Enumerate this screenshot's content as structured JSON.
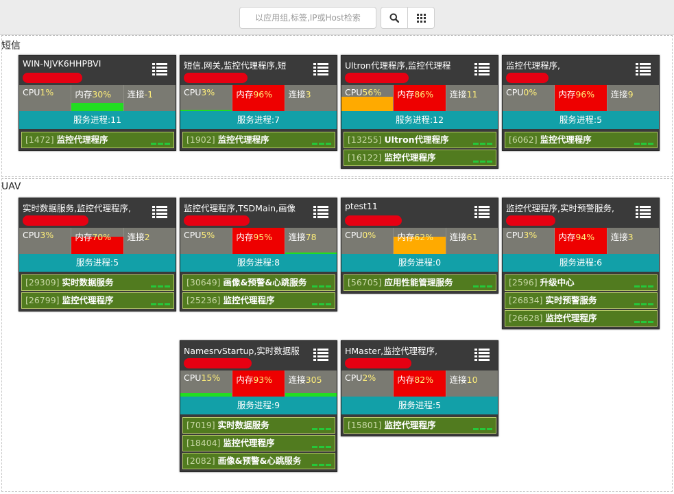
{
  "search": {
    "placeholder": "以应用组,标签,IP或Host检索"
  },
  "toolbar": {
    "search_icon": "search-icon",
    "grid_icon": "grid-icon"
  },
  "colors": {
    "high": "#ee0000",
    "warn": "#ffaa00",
    "ok": "#22dd22",
    "service_bar": "#12a0a8",
    "process": "#517b1f"
  },
  "labels": {
    "cpu": "CPU",
    "mem": "内存",
    "conn": "连接",
    "svc": "服务进程:"
  },
  "groups": [
    {
      "name": "短信",
      "cards": [
        {
          "title": "WIN-NJVK6HHPBVI",
          "cpu": "1%",
          "mem": "30%",
          "conn": "-1",
          "services": "11",
          "procs": [
            {
              "pid": "[1472]",
              "name": "监控代理程序"
            }
          ]
        },
        {
          "title": "短信.网关,监控代理程序,短",
          "cpu": "3%",
          "mem": "96%",
          "conn": "3",
          "services": "7",
          "procs": [
            {
              "pid": "[1902]",
              "name": "监控代理程序"
            }
          ]
        },
        {
          "title": "Ultron代理程序,监控代理程",
          "cpu": "56%",
          "mem": "86%",
          "conn": "11",
          "services": "12",
          "procs": [
            {
              "pid": "[13255]",
              "name": "Ultron代理程序"
            },
            {
              "pid": "[16122]",
              "name": "监控代理程序"
            }
          ]
        },
        {
          "title": "监控代理程序,",
          "cpu": "0%",
          "mem": "96%",
          "conn": "9",
          "services": "5",
          "procs": [
            {
              "pid": "[6062]",
              "name": "监控代理程序"
            }
          ]
        }
      ]
    },
    {
      "name": "UAV",
      "cards": [
        {
          "title": "实时数据服务,监控代理程序,",
          "cpu": "3%",
          "mem": "70%",
          "conn": "2",
          "services": "5",
          "procs": [
            {
              "pid": "[29309]",
              "name": "实时数据服务"
            },
            {
              "pid": "[26799]",
              "name": "监控代理程序"
            }
          ]
        },
        {
          "title": "监控代理程序,TSDMain,画像",
          "cpu": "5%",
          "mem": "95%",
          "conn": "78",
          "services": "8",
          "procs": [
            {
              "pid": "[30649]",
              "name": "画像&预警&心跳服务"
            },
            {
              "pid": "[25236]",
              "name": "监控代理程序"
            }
          ]
        },
        {
          "title": "ptest11",
          "cpu": "0%",
          "mem": "62%",
          "conn": "61",
          "services": "0",
          "procs": [
            {
              "pid": "[56705]",
              "name": "应用性能管理服务"
            }
          ]
        },
        {
          "title": "监控代理程序,实时预警服务,",
          "cpu": "3%",
          "mem": "94%",
          "conn": "3",
          "services": "6",
          "procs": [
            {
              "pid": "[2596]",
              "name": "升级中心"
            },
            {
              "pid": "[26834]",
              "name": "实时预警服务"
            },
            {
              "pid": "[26628]",
              "name": "监控代理程序"
            }
          ]
        },
        {
          "title": "NamesrvStartup,实时数据服",
          "cpu": "15%",
          "mem": "93%",
          "conn": "305",
          "services": "9",
          "procs": [
            {
              "pid": "[7019]",
              "name": "实时数据服务"
            },
            {
              "pid": "[18404]",
              "name": "监控代理程序"
            },
            {
              "pid": "[2082]",
              "name": "画像&预警&心跳服务"
            }
          ]
        },
        {
          "title": "HMaster,监控代理程序,",
          "cpu": "2%",
          "mem": "82%",
          "conn": "10",
          "services": "5",
          "procs": [
            {
              "pid": "[15801]",
              "name": "监控代理程序"
            }
          ]
        }
      ]
    }
  ]
}
